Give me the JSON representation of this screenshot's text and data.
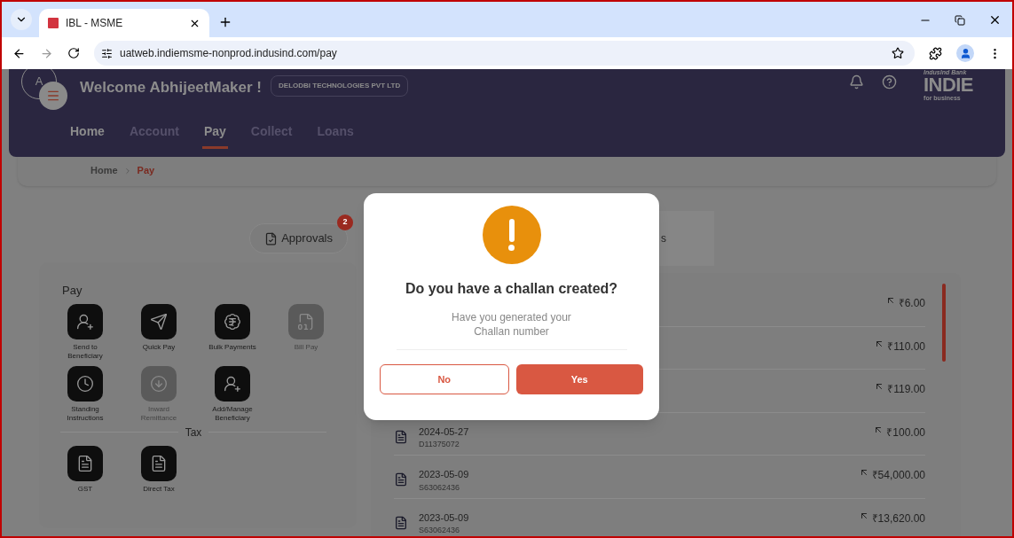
{
  "browser": {
    "tab_title": "IBL - MSME",
    "url": "uatweb.indiemsme-nonprod.indusind.com/pay"
  },
  "header": {
    "avatar_initial": "A",
    "welcome": "Welcome AbhijeetMaker !",
    "company": "DELODBI TECHNOLOGIES PVT LTD",
    "logo_top": "IndusInd Bank",
    "logo_main": "INDIE",
    "logo_bottom": "for business",
    "nav": [
      {
        "label": "Home",
        "selected": false
      },
      {
        "label": "Account",
        "selected": false
      },
      {
        "label": "Pay",
        "selected": true
      },
      {
        "label": "Collect",
        "selected": false
      },
      {
        "label": "Loans",
        "selected": false
      }
    ]
  },
  "breadcrumb": [
    {
      "label": "Home",
      "current": false
    },
    {
      "label": "Pay",
      "current": true
    }
  ],
  "approvals": {
    "label": "Approvals",
    "count": "2"
  },
  "pay_panel": {
    "title": "Pay",
    "items": [
      {
        "label": "Send to Beneficiary",
        "disabled": false
      },
      {
        "label": "Quick Pay",
        "disabled": false
      },
      {
        "label": "Bulk Payments",
        "disabled": false
      },
      {
        "label": "Bill Pay",
        "disabled": true
      },
      {
        "label": "Standing Instructions",
        "disabled": false
      },
      {
        "label": "Inward Remittance",
        "disabled": true
      },
      {
        "label": "Add/Manage Beneficiary",
        "disabled": false
      }
    ],
    "tax_title": "Tax",
    "tax_items": [
      {
        "label": "GST",
        "disabled": false
      },
      {
        "label": "Direct Tax",
        "disabled": false
      }
    ]
  },
  "transactions_tab": {
    "label": "s"
  },
  "transactions": [
    {
      "amount": "₹6.00"
    },
    {
      "amount": "₹110.00"
    },
    {
      "amount": "₹119.00"
    },
    {
      "date": "2024-05-27",
      "ref": "D11375072",
      "amount": "₹100.00"
    },
    {
      "date": "2023-05-09",
      "ref": "S63062436",
      "amount": "₹54,000.00"
    },
    {
      "date": "2023-05-09",
      "ref": "S63062436",
      "amount": "₹13,620.00"
    }
  ],
  "dialog": {
    "title": "Do you have a challan created?",
    "message": "Have you generated your Challan number",
    "buttons": [
      {
        "label": "No",
        "kind": "secondary"
      },
      {
        "label": "Yes",
        "kind": "primary"
      }
    ]
  }
}
